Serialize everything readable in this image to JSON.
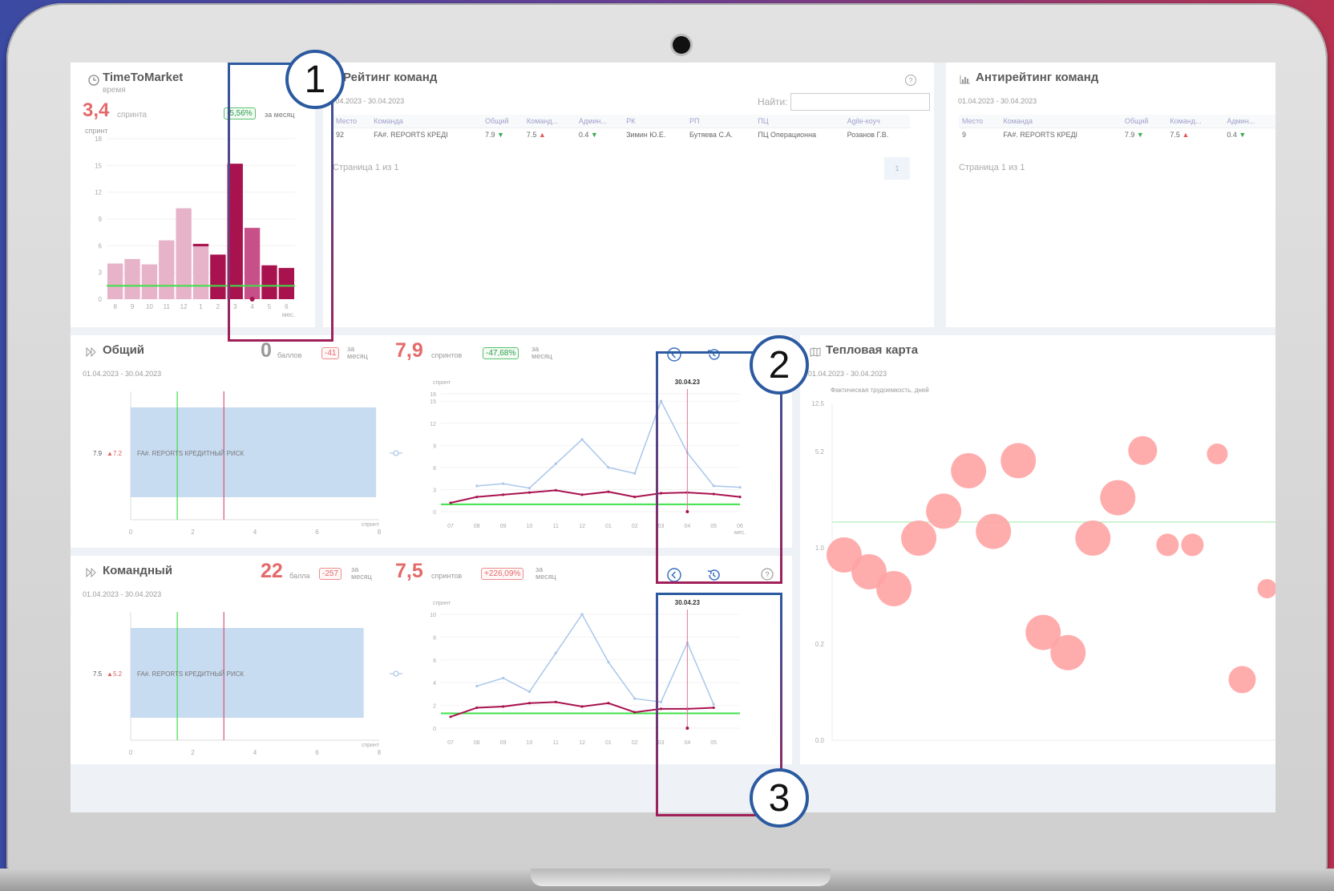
{
  "callouts": [
    "1",
    "2",
    "3"
  ],
  "ttm": {
    "title": "TimeToMarket",
    "subtitle": "время",
    "value": "3,4",
    "unit": "спринта",
    "badge": "-5,56%",
    "badge_suffix": "за месяц",
    "y_label": "спринт",
    "x_unit": "мес.",
    "chart_data": {
      "type": "bar",
      "categories": [
        "8",
        "9",
        "10",
        "11",
        "12",
        "1",
        "2",
        "3",
        "4",
        "5",
        "6"
      ],
      "yticks": [
        "0",
        "3",
        "6",
        "9",
        "12",
        "15",
        "18"
      ],
      "ylim": [
        0,
        18
      ],
      "series": [
        {
          "values": [
            4,
            4.5,
            3.9,
            6.6,
            10.2,
            6.2,
            5,
            15.2,
            8,
            3.8,
            3.5
          ]
        }
      ],
      "target_line": 1.5
    }
  },
  "rating": {
    "title": "Рейтинг команд",
    "period": "01.04.2023 - 30.04.2023",
    "search_label": "Найти:",
    "columns": [
      "Место",
      "Команда",
      "Общий",
      "Команд...",
      "Админ...",
      "РК",
      "РП",
      "ПЦ",
      "Agile-коуч"
    ],
    "row": [
      "92",
      "FA#. REPORTS КРЕДI",
      "7.9",
      "7.5",
      "0.4",
      "Зимин Ю.Е.",
      "Бутяева С.А.",
      "ПЦ Операционна",
      "Розанов Г.В."
    ],
    "pager": "Страница 1 из 1",
    "page_btn": "1"
  },
  "antirating": {
    "title": "Антирейтинг команд",
    "period": "01.04.2023 - 30.04.2023",
    "columns": [
      "Место",
      "Команда",
      "Общий",
      "Команд...",
      "Админ..."
    ],
    "row": [
      "9",
      "FA#. REPORTS КРЕДI",
      "7.9",
      "7.5",
      "0.4"
    ],
    "pager": "Страница 1 из 1"
  },
  "general": {
    "title": "Общий",
    "period": "01.04.2023 - 30.04.2023",
    "score": "0",
    "score_unit": "баллов",
    "score_delta": "-41",
    "score_delta_suffix": "за месяц",
    "sprints": "7,9",
    "sprints_unit": "спринтов",
    "sprints_delta": "-47,68%",
    "sprints_delta_suffix": "за месяц",
    "bar_label": "FA#. REPORTS КРЕДИТНЫЙ РИСК",
    "bar_value": "7.9",
    "bar_prev": "7.2",
    "bar_axis": [
      "0",
      "2",
      "4",
      "6",
      "8"
    ],
    "bar_axis_unit": "спринт",
    "date_marker": "30.04.23",
    "line_y_label": "спринт",
    "line_x_unit": "мес.",
    "chart_data": {
      "type": "line",
      "x": [
        "07",
        "08",
        "09",
        "10",
        "11",
        "12",
        "01",
        "02",
        "03",
        "04",
        "05",
        "06"
      ],
      "yticks": [
        "0",
        "3",
        "6",
        "9",
        "12",
        "15",
        "16"
      ],
      "ylim": [
        0,
        16
      ],
      "series": [
        {
          "values": [
            null,
            3.5,
            3.8,
            3.2,
            6.5,
            9.8,
            6,
            5.2,
            15,
            8,
            3.5,
            3.3
          ]
        },
        {
          "values": [
            1.2,
            2,
            2.3,
            2.6,
            2.9,
            2.3,
            2.7,
            2,
            2.5,
            2.6,
            2.4,
            2
          ]
        }
      ],
      "target_line": 1
    }
  },
  "team": {
    "title": "Командный",
    "period": "01.04.2023 - 30.04.2023",
    "score": "22",
    "score_unit": "балла",
    "score_delta": "-257",
    "score_delta_suffix": "за месяц",
    "sprints": "7,5",
    "sprints_unit": "спринтов",
    "sprints_delta": "+226,09%",
    "sprints_delta_suffix": "за месяц",
    "bar_label": "FA#. REPORTS КРЕДИТНЫЙ РИСК",
    "bar_value": "7.5",
    "bar_prev": "5.2",
    "bar_axis": [
      "0",
      "2",
      "4",
      "6",
      "8"
    ],
    "bar_axis_unit": "спринт",
    "date_marker": "30.04.23",
    "line_y_label": "спринт",
    "chart_data": {
      "type": "line",
      "x": [
        "07",
        "08",
        "09",
        "10",
        "11",
        "12",
        "01",
        "02",
        "03",
        "04",
        "05"
      ],
      "yticks": [
        "0",
        "2",
        "4",
        "6",
        "8",
        "10"
      ],
      "ylim": [
        0,
        10
      ],
      "series": [
        {
          "values": [
            null,
            3.7,
            4.4,
            3.2,
            6.6,
            10,
            5.8,
            2.6,
            2.3,
            7.5,
            2.1
          ]
        },
        {
          "values": [
            1,
            1.8,
            1.9,
            2.2,
            2.3,
            1.9,
            2.2,
            1.4,
            1.7,
            1.7,
            1.8
          ]
        }
      ],
      "target_line": 1.3
    }
  },
  "heatmap": {
    "title": "Тепловая карта",
    "period": "01.04.2023 - 30.04.2023",
    "y_label": "Фактическая трудоемкость, дней",
    "yticks": [
      "0.0",
      "0.2",
      "1.0",
      "5.2",
      "12.5"
    ],
    "chart_data": {
      "type": "scatter",
      "points": [
        {
          "x": 1,
          "y": 0.55,
          "r": 22
        },
        {
          "x": 2,
          "y": 0.5,
          "r": 22
        },
        {
          "x": 3,
          "y": 0.45,
          "r": 22
        },
        {
          "x": 4,
          "y": 0.6,
          "r": 22
        },
        {
          "x": 5,
          "y": 0.68,
          "r": 22
        },
        {
          "x": 6,
          "y": 0.8,
          "r": 22
        },
        {
          "x": 7,
          "y": 0.62,
          "r": 22
        },
        {
          "x": 8,
          "y": 0.83,
          "r": 22
        },
        {
          "x": 9,
          "y": 0.32,
          "r": 22
        },
        {
          "x": 10,
          "y": 0.26,
          "r": 22
        },
        {
          "x": 11,
          "y": 0.6,
          "r": 22
        },
        {
          "x": 12,
          "y": 0.72,
          "r": 22
        },
        {
          "x": 13,
          "y": 0.86,
          "r": 18
        },
        {
          "x": 14,
          "y": 0.58,
          "r": 14
        },
        {
          "x": 15,
          "y": 0.58,
          "r": 14
        },
        {
          "x": 16,
          "y": 0.85,
          "r": 13
        },
        {
          "x": 17,
          "y": 0.18,
          "r": 17
        },
        {
          "x": 18,
          "y": 0.45,
          "r": 12
        }
      ]
    }
  }
}
